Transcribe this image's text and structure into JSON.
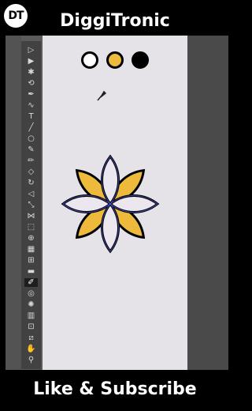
{
  "header": {
    "logo_text": "DT",
    "channel_name": "DiggiTronic"
  },
  "footer": {
    "cta": "Like & Subscribe"
  },
  "swatches": [
    {
      "name": "white",
      "color": "#ffffff"
    },
    {
      "name": "yellow",
      "color": "#edba3c"
    },
    {
      "name": "black",
      "color": "#000000"
    }
  ],
  "colors": {
    "petal_yellow": "#edba3c",
    "petal_light": "#ece6ef",
    "outline": "#000000",
    "selection": "#4b55c8"
  },
  "toolbar": {
    "tools": [
      {
        "name": "selection-tool",
        "glyph": "▷"
      },
      {
        "name": "direct-selection-tool",
        "glyph": "▶"
      },
      {
        "name": "magic-wand-tool",
        "glyph": "✱"
      },
      {
        "name": "lasso-tool",
        "glyph": "⟲"
      },
      {
        "name": "pen-tool",
        "glyph": "✒"
      },
      {
        "name": "curvature-tool",
        "glyph": "∿"
      },
      {
        "name": "type-tool",
        "glyph": "T"
      },
      {
        "name": "line-tool",
        "glyph": "╱"
      },
      {
        "name": "ellipse-tool",
        "glyph": "○"
      },
      {
        "name": "paintbrush-tool",
        "glyph": "✎"
      },
      {
        "name": "pencil-tool",
        "glyph": "✏"
      },
      {
        "name": "eraser-tool",
        "glyph": "◇"
      },
      {
        "name": "rotate-tool",
        "glyph": "↻"
      },
      {
        "name": "reflect-tool",
        "glyph": "◁"
      },
      {
        "name": "scale-tool",
        "glyph": "⤡"
      },
      {
        "name": "width-tool",
        "glyph": "⋈"
      },
      {
        "name": "free-transform-tool",
        "glyph": "⬚"
      },
      {
        "name": "shape-builder-tool",
        "glyph": "⊕"
      },
      {
        "name": "perspective-grid-tool",
        "glyph": "▦"
      },
      {
        "name": "mesh-tool",
        "glyph": "⊞"
      },
      {
        "name": "gradient-tool",
        "glyph": "▬"
      },
      {
        "name": "eyedropper-tool",
        "glyph": "✐"
      },
      {
        "name": "blend-tool",
        "glyph": "◎"
      },
      {
        "name": "symbol-sprayer-tool",
        "glyph": "✺"
      },
      {
        "name": "column-graph-tool",
        "glyph": "▥"
      },
      {
        "name": "artboard-tool",
        "glyph": "⊡"
      },
      {
        "name": "slice-tool",
        "glyph": "⧄"
      },
      {
        "name": "hand-tool",
        "glyph": "✋"
      },
      {
        "name": "zoom-tool",
        "glyph": "⚲"
      }
    ]
  }
}
